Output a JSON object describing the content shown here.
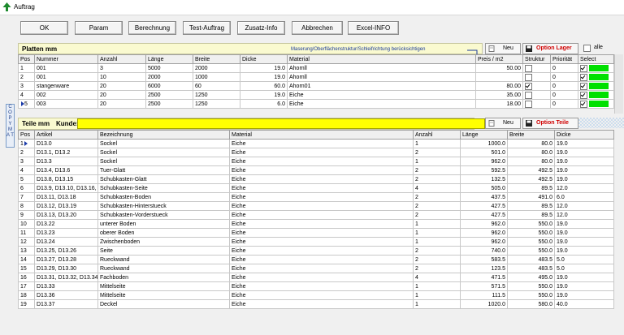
{
  "window": {
    "title": "Auftrag"
  },
  "toolbar": [
    {
      "label": "OK"
    },
    {
      "label": "Param"
    },
    {
      "label": "Berechnung"
    },
    {
      "label": "Test-Auftrag"
    },
    {
      "label": "Zusatz-Info"
    },
    {
      "label": "Abbrechen"
    },
    {
      "label": "Excel-INFO"
    }
  ],
  "side_tab": {
    "label": "C O P Y M A T"
  },
  "platten": {
    "title": "Platten mm",
    "hint": "Maserung/Oberflächenstruktur/Schleifrichtung berücksichtigen",
    "neu_label": "Neu",
    "option_lager_label": "Option Lager",
    "alle_label": "alle",
    "columns": [
      "Pos",
      "Nummer",
      "Anzahl",
      "Länge",
      "Breite",
      "Dicke",
      "Material",
      "Preis / m2",
      "Struktur",
      "Priorität",
      "Select"
    ],
    "rows": [
      {
        "pos": "1",
        "nummer": "001",
        "anzahl": "3",
        "laenge": "5000",
        "breite": "2000",
        "dicke": "19.0",
        "material": "Ahornll",
        "preis": "50.00",
        "struktur": false,
        "prioritaet": "0",
        "select": true
      },
      {
        "pos": "2",
        "nummer": "001",
        "anzahl": "10",
        "laenge": "2000",
        "breite": "1000",
        "dicke": "19.0",
        "material": "Ahornll",
        "preis": "",
        "struktur": false,
        "prioritaet": "0",
        "select": true
      },
      {
        "pos": "3",
        "nummer": "stangenware",
        "anzahl": "20",
        "laenge": "6000",
        "breite": "60",
        "dicke": "60.0",
        "material": "Ahorn01",
        "preis": "80.00",
        "struktur": true,
        "prioritaet": "0",
        "select": true
      },
      {
        "pos": "4",
        "nummer": "002",
        "anzahl": "20",
        "laenge": "2500",
        "breite": "1250",
        "dicke": "19.0",
        "material": "Eiche",
        "preis": "35.00",
        "struktur": false,
        "prioritaet": "0",
        "select": true
      },
      {
        "pos": "5",
        "nummer": "003",
        "anzahl": "20",
        "laenge": "2500",
        "breite": "1250",
        "dicke": "6.0",
        "material": "Eiche",
        "preis": "18.00",
        "struktur": false,
        "prioritaet": "0",
        "select": true
      }
    ]
  },
  "teile": {
    "title": "Teile mm",
    "kunde_label": "Kunde:",
    "kunde_value": "",
    "neu_label": "Neu",
    "option_teile_label": "Option Teile",
    "columns": [
      "Pos",
      "Artikel",
      "Bezeichnung",
      "Material",
      "Anzahl",
      "Länge",
      "Breite",
      "Dicke"
    ],
    "rows": [
      {
        "pos": "1",
        "artikel": "D13.0",
        "bezeichnung": "Sockel",
        "material": "Eiche",
        "anzahl": "1",
        "laenge": "1000.0",
        "breite": "80.0",
        "dicke": "19.0"
      },
      {
        "pos": "2",
        "artikel": "D13.1, D13.2",
        "bezeichnung": "Sockel",
        "material": "Eiche",
        "anzahl": "2",
        "laenge": "501.0",
        "breite": "80.0",
        "dicke": "19.0"
      },
      {
        "pos": "3",
        "artikel": "D13.3",
        "bezeichnung": "Sockel",
        "material": "Eiche",
        "anzahl": "1",
        "laenge": "962.0",
        "breite": "80.0",
        "dicke": "19.0"
      },
      {
        "pos": "4",
        "artikel": "D13.4, D13.6",
        "bezeichnung": "Tuer-Glatt",
        "material": "Eiche",
        "anzahl": "2",
        "laenge": "592.5",
        "breite": "492.5",
        "dicke": "19.0"
      },
      {
        "pos": "5",
        "artikel": "D13.8, D13.15",
        "bezeichnung": "Schubkasten-Glatt",
        "material": "Eiche",
        "anzahl": "2",
        "laenge": "132.5",
        "breite": "492.5",
        "dicke": "19.0"
      },
      {
        "pos": "6",
        "artikel": "D13.9, D13.10, D13.16, D",
        "bezeichnung": "Schubkasten-Seite",
        "material": "Eiche",
        "anzahl": "4",
        "laenge": "505.0",
        "breite": "89.5",
        "dicke": "12.0"
      },
      {
        "pos": "7",
        "artikel": "D13.11, D13.18",
        "bezeichnung": "Schubkasten-Boden",
        "material": "Eiche",
        "anzahl": "2",
        "laenge": "437.5",
        "breite": "491.0",
        "dicke": "6.0"
      },
      {
        "pos": "8",
        "artikel": "D13.12, D13.19",
        "bezeichnung": "Schubkasten-Hinterstueck",
        "material": "Eiche",
        "anzahl": "2",
        "laenge": "427.5",
        "breite": "89.5",
        "dicke": "12.0"
      },
      {
        "pos": "9",
        "artikel": "D13.13, D13.20",
        "bezeichnung": "Schubkasten-Vorderstueck",
        "material": "Eiche",
        "anzahl": "2",
        "laenge": "427.5",
        "breite": "89.5",
        "dicke": "12.0"
      },
      {
        "pos": "10",
        "artikel": "D13.22",
        "bezeichnung": "unterer Boden",
        "material": "Eiche",
        "anzahl": "1",
        "laenge": "962.0",
        "breite": "550.0",
        "dicke": "19.0"
      },
      {
        "pos": "11",
        "artikel": "D13.23",
        "bezeichnung": "oberer Boden",
        "material": "Eiche",
        "anzahl": "1",
        "laenge": "962.0",
        "breite": "550.0",
        "dicke": "19.0"
      },
      {
        "pos": "12",
        "artikel": "D13.24",
        "bezeichnung": "Zwischenboden",
        "material": "Eiche",
        "anzahl": "1",
        "laenge": "962.0",
        "breite": "550.0",
        "dicke": "19.0"
      },
      {
        "pos": "13",
        "artikel": "D13.25, D13.26",
        "bezeichnung": "Seite",
        "material": "Eiche",
        "anzahl": "2",
        "laenge": "740.0",
        "breite": "550.0",
        "dicke": "19.0"
      },
      {
        "pos": "14",
        "artikel": "D13.27, D13.28",
        "bezeichnung": "Rueckwand",
        "material": "Eiche",
        "anzahl": "2",
        "laenge": "583.5",
        "breite": "483.5",
        "dicke": "5.0"
      },
      {
        "pos": "15",
        "artikel": "D13.29, D13.30",
        "bezeichnung": "Rueckwand",
        "material": "Eiche",
        "anzahl": "2",
        "laenge": "123.5",
        "breite": "483.5",
        "dicke": "5.0"
      },
      {
        "pos": "16",
        "artikel": "D13.31, D13.32, D13.34,",
        "bezeichnung": "Fachboden",
        "material": "Eiche",
        "anzahl": "4",
        "laenge": "471.5",
        "breite": "495.0",
        "dicke": "19.0"
      },
      {
        "pos": "17",
        "artikel": "D13.33",
        "bezeichnung": "Mittelseite",
        "material": "Eiche",
        "anzahl": "1",
        "laenge": "571.5",
        "breite": "550.0",
        "dicke": "19.0"
      },
      {
        "pos": "18",
        "artikel": "D13.36",
        "bezeichnung": "Mittelseite",
        "material": "Eiche",
        "anzahl": "1",
        "laenge": "111.5",
        "breite": "550.0",
        "dicke": "19.0"
      },
      {
        "pos": "19",
        "artikel": "D13.37",
        "bezeichnung": "Deckel",
        "material": "Eiche",
        "anzahl": "1",
        "laenge": "1020.0",
        "breite": "580.0",
        "dicke": "40.0"
      }
    ]
  },
  "colors": {
    "select_green": "#00e000",
    "kunde_yellow": "#ffff00",
    "section_bg": "#fafad0",
    "option_red": "#d00000",
    "hint_blue": "#1a3a9a"
  }
}
